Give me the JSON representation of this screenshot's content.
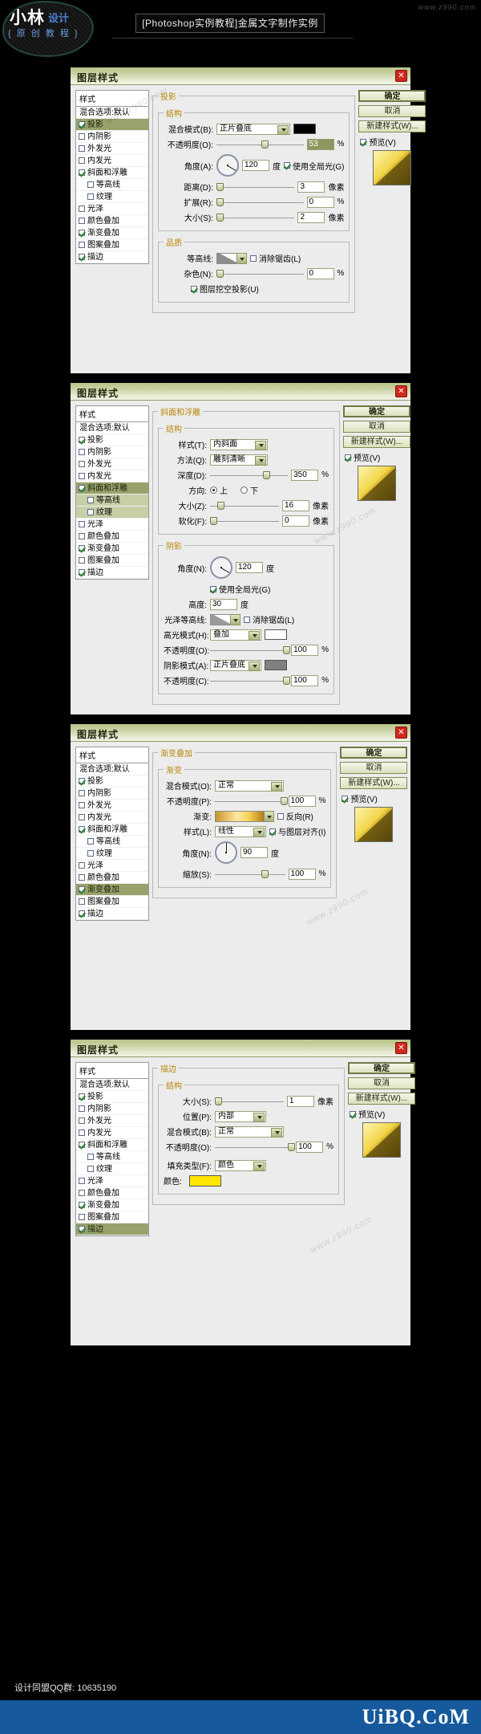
{
  "banner": {
    "logo_main": "小林",
    "logo_sub": "设计",
    "logo_line2": "{ 原 创 教 程 }",
    "title": "[Photoshop实例教程]金属文字制作实例",
    "watermark": "www.z990.com"
  },
  "common": {
    "dialog_title": "图层样式",
    "close": "✕",
    "styles_head": "样式",
    "blend_option": "混合选项:默认",
    "buttons": {
      "ok": "确定",
      "cancel": "取消",
      "new_style": "新建样式(W)...",
      "preview": "预览(V)"
    },
    "style_items": [
      {
        "label": "投影",
        "checked": true,
        "indent": false
      },
      {
        "label": "内阴影",
        "checked": false,
        "indent": false
      },
      {
        "label": "外发光",
        "checked": false,
        "indent": false
      },
      {
        "label": "内发光",
        "checked": false,
        "indent": false
      },
      {
        "label": "斜面和浮雕",
        "checked": true,
        "indent": false
      },
      {
        "label": "等高线",
        "checked": false,
        "indent": true
      },
      {
        "label": "纹理",
        "checked": false,
        "indent": true
      },
      {
        "label": "光泽",
        "checked": false,
        "indent": false
      },
      {
        "label": "颜色叠加",
        "checked": false,
        "indent": false
      },
      {
        "label": "渐变叠加",
        "checked": true,
        "indent": false
      },
      {
        "label": "图案叠加",
        "checked": false,
        "indent": false
      },
      {
        "label": "描边",
        "checked": true,
        "indent": false
      }
    ]
  },
  "dialog1": {
    "selected_style": "投影",
    "group_title": "投影",
    "sub_group": "结构",
    "blend_mode_label": "混合模式(B):",
    "blend_mode_value": "正片叠底",
    "blend_mode_swatch": "#000000",
    "opacity_label": "不透明度(O):",
    "opacity_value": "53",
    "opacity_unit": "%",
    "angle_label": "角度(A):",
    "angle_value": "120",
    "angle_unit": "度",
    "use_global_light": "使用全局光(G)",
    "distance_label": "距离(D):",
    "distance_value": "3",
    "distance_unit": "像素",
    "spread_label": "扩展(R):",
    "spread_value": "0",
    "spread_unit": "%",
    "size_label": "大小(S):",
    "size_value": "2",
    "size_unit": "像素",
    "quality_title": "品质",
    "contour_label": "等高线:",
    "antialias_label": "消除锯齿(L)",
    "noise_label": "杂色(N):",
    "noise_value": "0",
    "noise_unit": "%",
    "knockout_label": "图层挖空投影(U)"
  },
  "dialog2": {
    "selected_style": "斜面和浮雕",
    "group_title": "斜面和浮雕",
    "sub_group": "结构",
    "style_label": "样式(T):",
    "style_value": "内斜面",
    "technique_label": "方法(Q):",
    "technique_value": "雕刻清晰",
    "depth_label": "深度(D):",
    "depth_value": "350",
    "depth_unit": "%",
    "direction_label": "方向:",
    "direction_up": "上",
    "direction_down": "下",
    "size_label": "大小(Z):",
    "size_value": "16",
    "size_unit": "像素",
    "soften_label": "软化(F):",
    "soften_value": "0",
    "soften_unit": "像素",
    "shading_title": "阴影",
    "angle_label": "角度(N):",
    "angle_value": "120",
    "angle_unit": "度",
    "use_global_light": "使用全局光(G)",
    "altitude_label": "高度:",
    "altitude_value": "30",
    "altitude_unit": "度",
    "gloss_contour_label": "光泽等高线:",
    "antialias_label": "消除锯齿(L)",
    "highlight_mode_label": "高光模式(H):",
    "highlight_mode_value": "叠加",
    "highlight_swatch": "#ffffff",
    "highlight_opacity_label": "不透明度(O):",
    "highlight_opacity_value": "100",
    "highlight_opacity_unit": "%",
    "shadow_mode_label": "阴影模式(A):",
    "shadow_mode_value": "正片叠底",
    "shadow_swatch": "#808080",
    "shadow_opacity_label": "不透明度(C):",
    "shadow_opacity_value": "100",
    "shadow_opacity_unit": "%"
  },
  "dialog3": {
    "selected_style": "渐变叠加",
    "group_title": "渐变叠加",
    "sub_group": "渐变",
    "blend_mode_label": "混合模式(O):",
    "blend_mode_value": "正常",
    "opacity_label": "不透明度(P):",
    "opacity_value": "100",
    "opacity_unit": "%",
    "gradient_label": "渐变:",
    "reverse_label": "反向(R)",
    "style_label": "样式(L):",
    "style_value": "线性",
    "align_label": "与图层对齐(I)",
    "angle_label": "角度(N):",
    "angle_value": "90",
    "angle_unit": "度",
    "scale_label": "缩放(S):",
    "scale_value": "100",
    "scale_unit": "%"
  },
  "dialog4": {
    "selected_style": "描边",
    "group_title": "描边",
    "sub_group": "结构",
    "size_label": "大小(S):",
    "size_value": "1",
    "size_unit": "像素",
    "position_label": "位置(P):",
    "position_value": "内部",
    "blend_mode_label": "混合模式(B):",
    "blend_mode_value": "正常",
    "opacity_label": "不透明度(O):",
    "opacity_value": "100",
    "opacity_unit": "%",
    "fill_type_label": "填充类型(F):",
    "fill_type_value": "颜色",
    "color_label": "颜色:",
    "color_swatch": "#ffe600"
  },
  "footer": {
    "qq": "设计同盟QQ群: 10635190",
    "brand": "UiBQ.CoM"
  },
  "watermarks": [
    "www.z990.com",
    "www.z990.com",
    "www.z990.com",
    "www.z990.com",
    "www.z990.com"
  ]
}
